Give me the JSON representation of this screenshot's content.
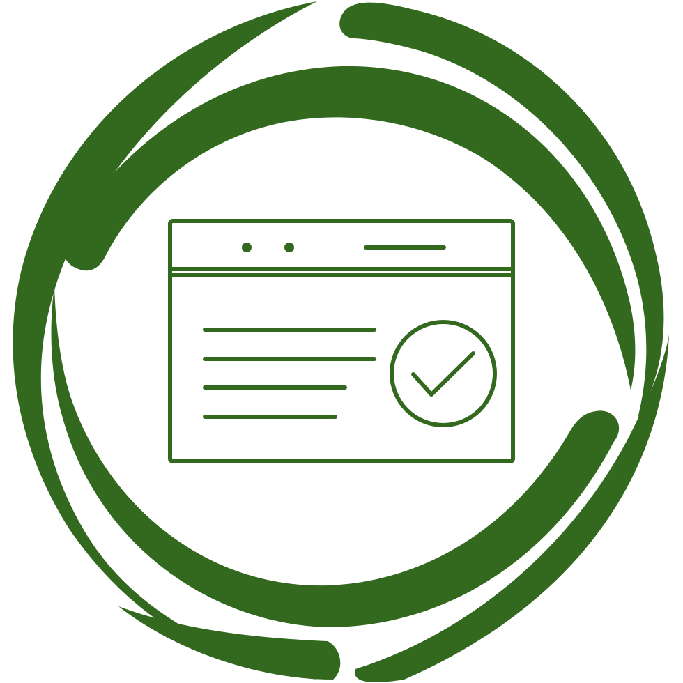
{
  "icon": {
    "name": "verified-webpage-icon",
    "color": "#33691e",
    "background": "#ffffff",
    "parts": [
      "swirl-ring-icon",
      "browser-window-icon",
      "checkmark-circle-icon"
    ]
  }
}
